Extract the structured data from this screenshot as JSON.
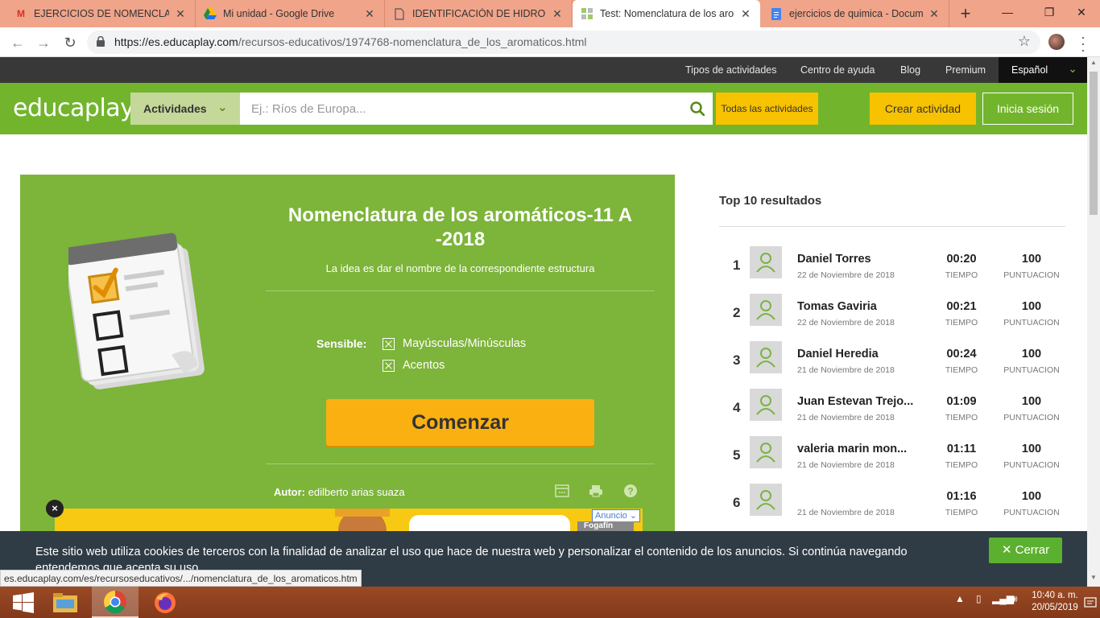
{
  "browser": {
    "tabs": [
      {
        "title": "EJERCICIOS DE NOMENCLATUR",
        "icon": "gmail-icon"
      },
      {
        "title": "Mi unidad - Google Drive",
        "icon": "drive-icon"
      },
      {
        "title": "IDENTIFICACIÓN DE HIDROCAR",
        "icon": "document-icon"
      },
      {
        "title": "Test: Nomenclatura de los arom",
        "icon": "educaplay-icon"
      },
      {
        "title": "ejercicios de quimica - Docume",
        "icon": "docs-icon"
      }
    ],
    "url_host": "https://es.educaplay.com",
    "url_path": "/recursos-educativos/1974768-nomenclatura_de_los_aromaticos.html",
    "window_buttons": {
      "minimize": "—",
      "restore": "❐",
      "close": "✕"
    }
  },
  "topnav": {
    "links": [
      "Tipos de actividades",
      "Centro de ayuda",
      "Blog",
      "Premium"
    ],
    "language": "Español"
  },
  "header": {
    "logo_left": "educa",
    "logo_right": "play",
    "category_dropdown": "Actividades",
    "search_placeholder": "Ej.: Ríos de Europa...",
    "all_activities": "Todas las actividades",
    "create_activity": "Crear actividad",
    "login": "Inicia sesión"
  },
  "activity": {
    "title": "Nomenclatura de los aromáticos-11 A -2018",
    "subtitle": "La idea es dar el nombre de la correspondiente estructura",
    "sensitive_label": "Sensible:",
    "options": [
      "Mayúsculas/Minúsculas",
      "Acentos"
    ],
    "start_button": "Comenzar",
    "author_label": "Autor:",
    "author_name": "edilberto arias suaza"
  },
  "ad": {
    "label": "Anuncio",
    "brand": "Fogafín",
    "close": "×"
  },
  "ranking": {
    "title": "Top 10 resultados",
    "time_label": "TIEMPO",
    "score_label": "PUNTUACION",
    "rows": [
      {
        "pos": "1",
        "name": "Daniel Torres",
        "date": "22 de Noviembre de 2018",
        "time": "00:20",
        "score": "100"
      },
      {
        "pos": "2",
        "name": "Tomas Gaviria",
        "date": "22 de Noviembre de 2018",
        "time": "00:21",
        "score": "100"
      },
      {
        "pos": "3",
        "name": "Daniel Heredia",
        "date": "21 de Noviembre de 2018",
        "time": "00:24",
        "score": "100"
      },
      {
        "pos": "4",
        "name": "Juan Estevan Trejo...",
        "date": "21 de Noviembre de 2018",
        "time": "01:09",
        "score": "100"
      },
      {
        "pos": "5",
        "name": "valeria marin mon...",
        "date": "21 de Noviembre de 2018",
        "time": "01:11",
        "score": "100"
      },
      {
        "pos": "6",
        "name": "",
        "date": "21 de Noviembre de 2018",
        "time": "01:16",
        "score": "100"
      }
    ]
  },
  "cookie": {
    "text": "Este sitio web utiliza cookies de terceros con la finalidad de analizar el uso que hace de nuestra web y personalizar el contenido de los anuncios. Si continúa navegando entendemos que acepta su uso.",
    "close": "Cerrar"
  },
  "status_url": "es.educaplay.com/es/recursoseducativos/.../nomenclatura_de_los_aromaticos.htm",
  "taskbar": {
    "time": "10:40 a. m.",
    "date": "20/05/2019"
  },
  "colors": {
    "brand_green": "#72b52d",
    "card_green": "#7db43a",
    "accent_yellow": "#f7c200",
    "start_orange": "#fbb012",
    "tabbar": "#f0a48a",
    "taskbar": "#8e4220"
  }
}
